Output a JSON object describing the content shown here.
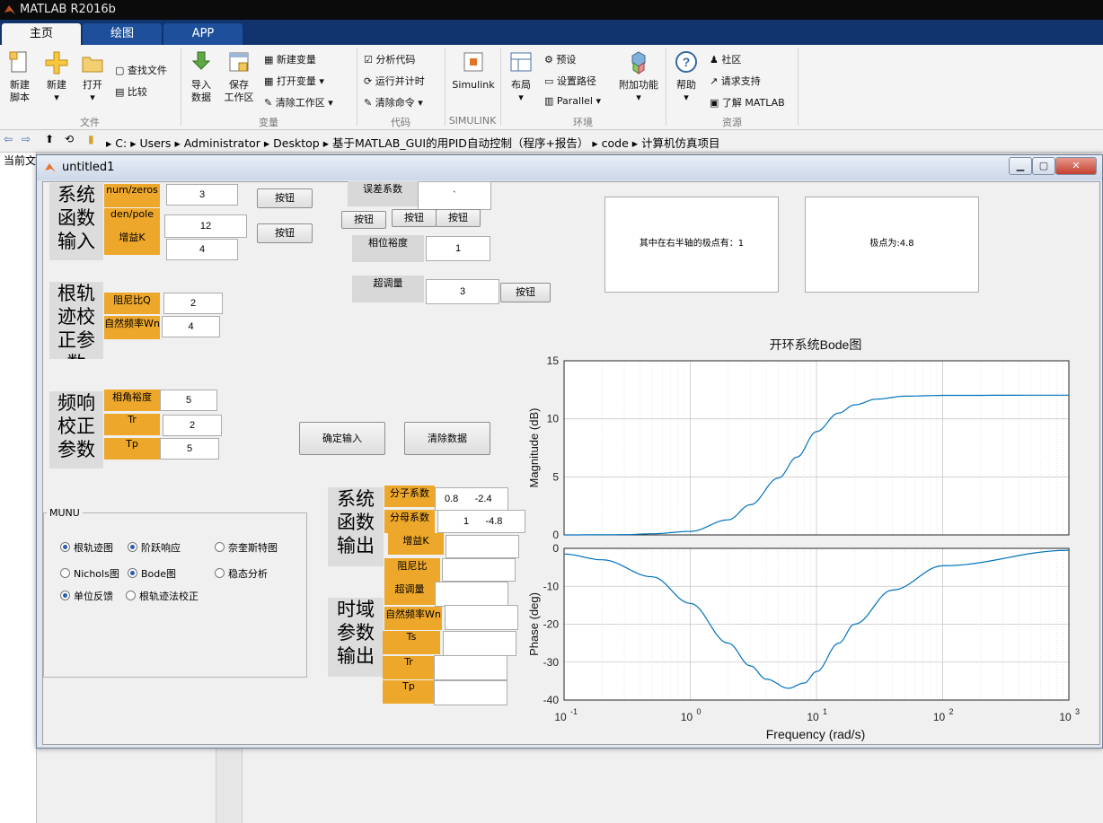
{
  "app": {
    "title": "MATLAB R2016b"
  },
  "tabs": [
    "主页",
    "绘图",
    "APP"
  ],
  "ribbon": {
    "file": {
      "new_script": "新建\n脚本",
      "new": "新建",
      "open": "打开",
      "find_files": "查找文件",
      "compare": "比较",
      "group": "文件"
    },
    "variable": {
      "import": "导入\n数据",
      "save_ws": "保存\n工作区",
      "new_var": "新建变量",
      "open_var": "打开变量",
      "clear_ws": "清除工作区",
      "group": "变量"
    },
    "code": {
      "analyze": "分析代码",
      "run_time": "运行并计时",
      "clear_cmd": "清除命令",
      "group": "代码"
    },
    "simulink": {
      "label": "Simulink",
      "group": "SIMULINK"
    },
    "env": {
      "layout": "布局",
      "prefs": "预设",
      "set_path": "设置路径",
      "parallel": "Parallel",
      "addons": "附加功能",
      "group": "环境"
    },
    "resources": {
      "help": "帮助",
      "community": "社区",
      "request_support": "请求支持",
      "learn": "了解 MATLAB",
      "group": "资源"
    }
  },
  "address": {
    "crumbs": [
      "C:",
      "Users",
      "Administrator",
      "Desktop",
      "基于MATLAB_GUI的用PID自动控制（程序+报告）",
      "code",
      "计算机仿真项目"
    ]
  },
  "left_pane": {
    "header": "当前文"
  },
  "figure": {
    "title": "untitled1",
    "sys_input": {
      "title": "系统\n函数\n输入",
      "num_label": "num/zeros",
      "num_value": "3",
      "den_label": "den/pole",
      "den_value": "12",
      "gain_label": "增益K",
      "gain_value": "4",
      "button1": "按钮",
      "button2": "按钮"
    },
    "error": {
      "label": "误差系数",
      "value": "`"
    },
    "mid_buttons": [
      "按钮",
      "按钮",
      "按钮"
    ],
    "phase_margin": {
      "label": "相位裕度",
      "value": "1"
    },
    "overshoot": {
      "label": "超调量",
      "value": "3",
      "button": "按钮"
    },
    "right_poles": "其中在右半轴的极点有：1",
    "poles": "极点为:4.8",
    "root_locus": {
      "title": "根轨\n迹校\n正参\n数",
      "damping_label": "阻尼比Q",
      "damping_value": "2",
      "wn_label": "自然频率Wn",
      "wn_value": "4"
    },
    "freq": {
      "title": "频响\n校正\n参数",
      "pm_label": "相角裕度",
      "pm_value": "5",
      "tr_label": "Tr",
      "tr_value": "2",
      "tp_label": "Tp",
      "tp_value": "5"
    },
    "confirm_button": "确定输入",
    "clear_button": "清除数据",
    "menu": {
      "title": "MUNU",
      "options": [
        {
          "label": "根轨迹图",
          "on": true
        },
        {
          "label": "阶跃响应",
          "on": true
        },
        {
          "label": "奈奎斯特图",
          "on": false
        },
        {
          "label": "Nichols图",
          "on": false
        },
        {
          "label": "Bode图",
          "on": true
        },
        {
          "label": "稳态分析",
          "on": false
        },
        {
          "label": "单位反馈",
          "on": true
        },
        {
          "label": "根轨迹法校正",
          "on": false
        }
      ]
    },
    "sys_output": {
      "title": "系统\n函数\n输出",
      "num_label": "分子系数",
      "num_value": "0.8      -2.4",
      "den_label": "分母系数",
      "den_value": "1      -4.8",
      "gain_label": "增益K",
      "damping_label": "阻尼比",
      "overshoot_label": "超调量"
    },
    "time_output": {
      "title": "时域\n参数\n输出",
      "wn_label": "自然频率Wn",
      "ts_label": "Ts",
      "tr_label": "Tr",
      "tp_label": "Tp"
    }
  },
  "chart_data": {
    "type": "line",
    "title": "开环系统Bode图",
    "xlabel": "Frequency  (rad/s)",
    "x_scale": "log",
    "xlim": [
      0.1,
      1000
    ],
    "x_ticks": [
      "10^-1",
      "10^0",
      "10^1",
      "10^2",
      "10^3"
    ],
    "line_color": "#0072bd",
    "magnitude": {
      "ylabel": "Magnitude (dB)",
      "ylim": [
        0,
        15
      ],
      "y_ticks": [
        0,
        5,
        10,
        15
      ],
      "x": [
        0.1,
        0.3,
        0.5,
        1,
        2,
        3,
        5,
        7,
        10,
        15,
        20,
        30,
        50,
        100,
        1000
      ],
      "y": [
        0.0,
        0.02,
        0.1,
        0.3,
        1.3,
        2.6,
        4.9,
        6.7,
        8.9,
        10.5,
        11.2,
        11.7,
        11.95,
        12.02,
        12.04
      ]
    },
    "phase": {
      "ylabel": "Phase (deg)",
      "ylim": [
        -40,
        0
      ],
      "y_ticks": [
        0,
        -10,
        -20,
        -30,
        -40
      ],
      "x": [
        0.1,
        0.2,
        0.5,
        1,
        2,
        3,
        4,
        6,
        8,
        10,
        15,
        20,
        40,
        100,
        1000
      ],
      "y": [
        -1.5,
        -3,
        -7.5,
        -14.5,
        -25,
        -31,
        -34.5,
        -36.9,
        -35.5,
        -32.5,
        -25,
        -20,
        -11,
        -4.6,
        -0.5
      ]
    }
  }
}
